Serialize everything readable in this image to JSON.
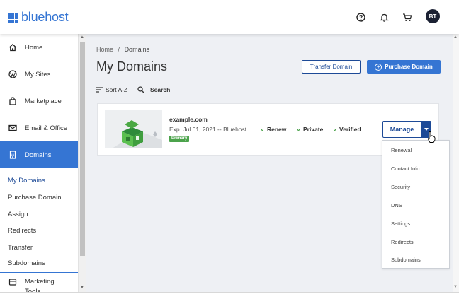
{
  "brand": {
    "name": "bluehost",
    "color": "#3575d3"
  },
  "header": {
    "help_icon": "help-circle-icon",
    "notifications_icon": "bell-icon",
    "cart_icon": "cart-icon",
    "avatar_initials": "BT"
  },
  "sidebar": {
    "items": [
      {
        "label": "Home",
        "icon": "home-icon"
      },
      {
        "label": "My Sites",
        "icon": "wordpress-icon"
      },
      {
        "label": "Marketplace",
        "icon": "shopping-bag-icon"
      },
      {
        "label": "Email & Office",
        "icon": "mail-icon"
      },
      {
        "label": "Domains",
        "icon": "building-icon",
        "active": true
      }
    ],
    "sub_items": [
      {
        "label": "My Domains",
        "current": true
      },
      {
        "label": "Purchase Domain"
      },
      {
        "label": "Assign"
      },
      {
        "label": "Redirects"
      },
      {
        "label": "Transfer"
      },
      {
        "label": "Subdomains"
      }
    ],
    "bottom_item": {
      "label": "Marketing Tools",
      "icon": "marketing-icon"
    }
  },
  "main": {
    "breadcrumb": {
      "home": "Home",
      "separator": "/",
      "current": "Domains"
    },
    "title": "My Domains",
    "transfer_button": "Transfer Domain",
    "purchase_button": "Purchase Domain",
    "sort_label": "Sort A-Z",
    "search_label": "Search"
  },
  "domain": {
    "name": "example.com",
    "expiry": "Exp. Jul 01, 2021 -- Bluehost",
    "badge": "Primary",
    "features": [
      "Renew",
      "Private",
      "Verified"
    ],
    "manage_label": "Manage"
  },
  "dropdown": {
    "items": [
      "Renewal",
      "Contact Info",
      "Security",
      "DNS",
      "Settings",
      "Redirects",
      "Subdomains"
    ]
  },
  "colors": {
    "accent": "#3575d3",
    "dark_blue": "#1d4a97",
    "success": "#4ca34c",
    "background": "#eef0f4"
  }
}
